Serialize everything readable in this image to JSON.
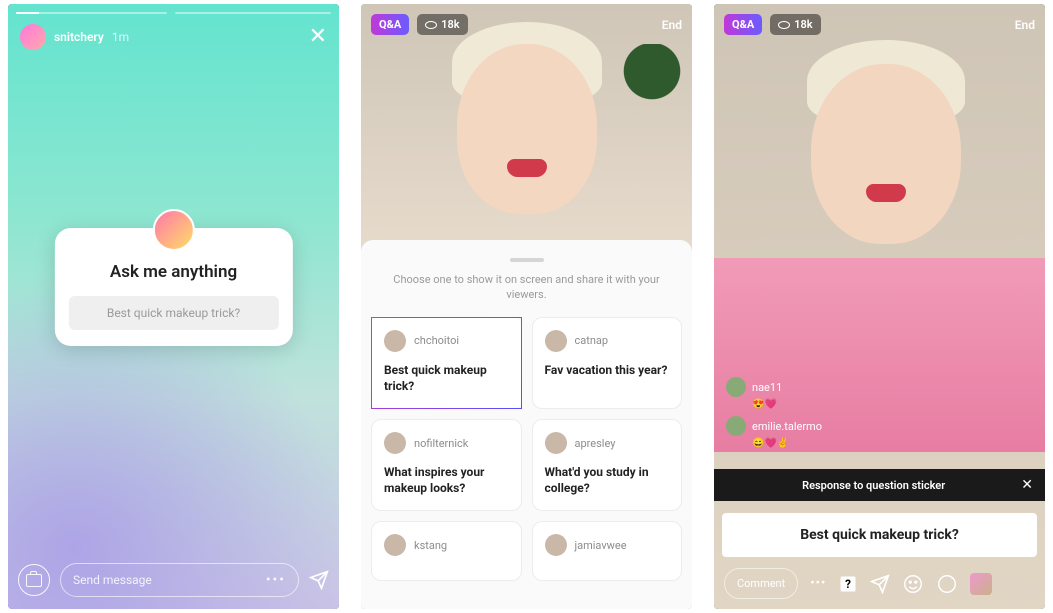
{
  "screen1": {
    "username": "snitchery",
    "time_ago": "1m",
    "prompt": "Ask me anything",
    "answer_placeholder": "Best quick makeup trick?",
    "send_placeholder": "Send message"
  },
  "screen2": {
    "qa_label": "Q&A",
    "viewer_count": "18k",
    "end_label": "End",
    "sheet_caption": "Choose one to show it on screen and share it with your viewers.",
    "questions": [
      {
        "user": "chchoitoi",
        "text": "Best quick makeup trick?",
        "selected": true
      },
      {
        "user": "catnap",
        "text": "Fav vacation this year?",
        "selected": false
      },
      {
        "user": "nofilternick",
        "text": "What inspires your makeup looks?",
        "selected": false
      },
      {
        "user": "apresley",
        "text": "What'd you study in college?",
        "selected": false
      },
      {
        "user": "kstang",
        "text": "",
        "selected": false
      },
      {
        "user": "jamiavwee",
        "text": "",
        "selected": false
      }
    ]
  },
  "screen3": {
    "qa_label": "Q&A",
    "viewer_count": "18k",
    "end_label": "End",
    "comments": [
      {
        "user": "nae11",
        "reaction": "😍💗"
      },
      {
        "user": "emilie.talermo",
        "reaction": "😄💗✌️"
      }
    ],
    "response_title": "Response to question sticker",
    "response_text": "Best quick makeup trick?",
    "comment_placeholder": "Comment",
    "more_label": "•••"
  }
}
